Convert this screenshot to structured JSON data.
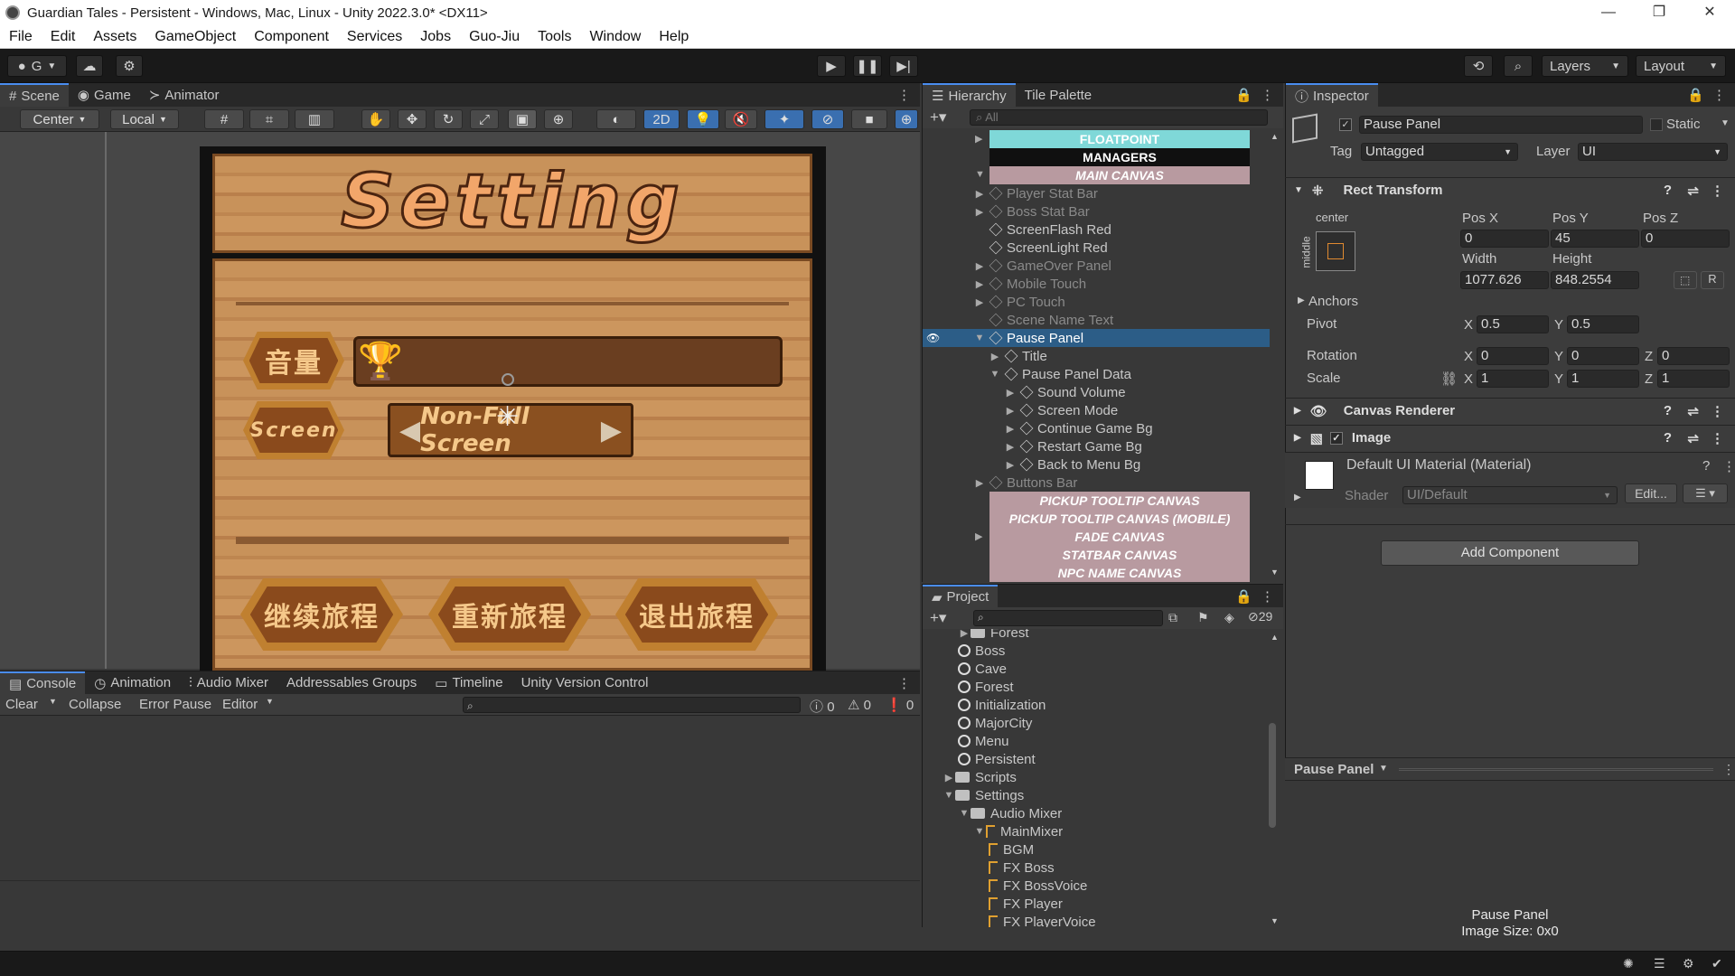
{
  "window": {
    "title": "Guardian Tales - Persistent - Windows, Mac, Linux - Unity 2022.3.0* <DX11>",
    "minimize": "—",
    "restore": "❐",
    "close": "✕"
  },
  "menu": [
    "File",
    "Edit",
    "Assets",
    "GameObject",
    "Component",
    "Services",
    "Jobs",
    "Guo-Jiu",
    "Tools",
    "Window",
    "Help"
  ],
  "toolbar": {
    "account": "G",
    "layers": "Layers",
    "layout": "Layout"
  },
  "scene_tabs": {
    "scene": "Scene",
    "game": "Game",
    "animator": "Animator"
  },
  "scene_bar": {
    "pivot": "Center",
    "space": "Local",
    "mode_2d": "2D"
  },
  "game_ui": {
    "title": "Setting",
    "volume_label": "音量",
    "screen_label": "Screen",
    "screen_mode_value": "Non-Full Screen",
    "volume_level": 0,
    "buttons": [
      "继续旅程",
      "重新旅程",
      "退出旅程"
    ]
  },
  "hierarchy": {
    "tab": "Hierarchy",
    "tab2": "Tile Palette",
    "search_placeholder": "All",
    "rows": [
      {
        "label": "FLOATPOINT",
        "kind": "bar",
        "bg": "#7fd8d8",
        "fg": "#ffffff",
        "italic": false
      },
      {
        "label": "MANAGERS",
        "kind": "bar",
        "bg": "#101010",
        "fg": "#ffffff",
        "italic": false
      },
      {
        "label": "MAIN CANVAS",
        "kind": "bar",
        "bg": "#b89aa0",
        "fg": "#ffffff",
        "italic": true
      },
      {
        "label": "Player Stat Bar",
        "indent": 1,
        "dim": true,
        "arrow": "▶"
      },
      {
        "label": "Boss Stat Bar",
        "indent": 1,
        "dim": true,
        "arrow": "▶"
      },
      {
        "label": "ScreenFlash Red",
        "indent": 1,
        "dim": false,
        "arrow": ""
      },
      {
        "label": "ScreenLight Red",
        "indent": 1,
        "dim": false,
        "arrow": ""
      },
      {
        "label": "GameOver Panel",
        "indent": 1,
        "dim": true,
        "arrow": "▶"
      },
      {
        "label": "Mobile Touch",
        "indent": 1,
        "dim": true,
        "arrow": "▶"
      },
      {
        "label": "PC Touch",
        "indent": 1,
        "dim": true,
        "arrow": "▶"
      },
      {
        "label": "Scene Name Text",
        "indent": 1,
        "dim": true,
        "arrow": ""
      },
      {
        "label": "Pause Panel",
        "indent": 1,
        "dim": false,
        "arrow": "▼",
        "selected": true
      },
      {
        "label": "Title",
        "indent": 2,
        "dim": false,
        "arrow": "▶"
      },
      {
        "label": "Pause Panel Data",
        "indent": 2,
        "dim": false,
        "arrow": "▼"
      },
      {
        "label": "Sound Volume",
        "indent": 3,
        "dim": false,
        "arrow": "▶"
      },
      {
        "label": "Screen Mode",
        "indent": 3,
        "dim": false,
        "arrow": "▶"
      },
      {
        "label": "Continue Game Bg",
        "indent": 3,
        "dim": false,
        "arrow": "▶"
      },
      {
        "label": "Restart Game Bg",
        "indent": 3,
        "dim": false,
        "arrow": "▶"
      },
      {
        "label": "Back to Menu Bg",
        "indent": 3,
        "dim": false,
        "arrow": "▶"
      },
      {
        "label": "Buttons Bar",
        "indent": 1,
        "dim": true,
        "arrow": "▶"
      },
      {
        "label": "PICKUP TOOLTIP CANVAS",
        "kind": "bar",
        "bg": "#b89aa0",
        "fg": "#ffffff",
        "italic": true
      },
      {
        "label": "PICKUP TOOLTIP CANVAS  (MOBILE)",
        "kind": "bar",
        "bg": "#b89aa0",
        "fg": "#ffffff",
        "italic": true
      },
      {
        "label": "FADE CANVAS",
        "kind": "bar",
        "bg": "#b89aa0",
        "fg": "#ffffff",
        "italic": true
      },
      {
        "label": "STATBAR CANVAS",
        "kind": "bar",
        "bg": "#b89aa0",
        "fg": "#ffffff",
        "italic": true
      },
      {
        "label": "NPC NAME CANVAS",
        "kind": "bar",
        "bg": "#b89aa0",
        "fg": "#ffffff",
        "italic": true
      }
    ]
  },
  "project": {
    "tab": "Project",
    "hidden_count": "29",
    "rows": [
      {
        "label": "Forest",
        "indent": 1,
        "icon": "folder",
        "arrow": "▶"
      },
      {
        "label": "Boss",
        "indent": 1,
        "icon": "unity"
      },
      {
        "label": "Cave",
        "indent": 1,
        "icon": "unity"
      },
      {
        "label": "Forest",
        "indent": 1,
        "icon": "unity"
      },
      {
        "label": "Initialization",
        "indent": 1,
        "icon": "unity"
      },
      {
        "label": "MajorCity",
        "indent": 1,
        "icon": "unity"
      },
      {
        "label": "Menu",
        "indent": 1,
        "icon": "unity"
      },
      {
        "label": "Persistent",
        "indent": 1,
        "icon": "unity"
      },
      {
        "label": "Scripts",
        "indent": 0,
        "icon": "folder",
        "arrow": "▶"
      },
      {
        "label": "Settings",
        "indent": 0,
        "icon": "folder",
        "arrow": "▼"
      },
      {
        "label": "Audio Mixer",
        "indent": 1,
        "icon": "folder",
        "arrow": "▼"
      },
      {
        "label": "MainMixer",
        "indent": 2,
        "icon": "mixer",
        "arrow": "▼"
      },
      {
        "label": "BGM",
        "indent": 3,
        "icon": "group"
      },
      {
        "label": "FX Boss",
        "indent": 3,
        "icon": "group"
      },
      {
        "label": "FX BossVoice",
        "indent": 3,
        "icon": "group"
      },
      {
        "label": "FX Player",
        "indent": 3,
        "icon": "group"
      },
      {
        "label": "FX PlayerVoice",
        "indent": 3,
        "icon": "group"
      }
    ]
  },
  "console": {
    "tabs": [
      "Console",
      "Animation",
      "Audio Mixer",
      "Addressables Groups",
      "Timeline",
      "Unity Version Control"
    ],
    "clear": "Clear",
    "collapse": "Collapse",
    "error_pause": "Error Pause",
    "editor": "Editor",
    "count_log": "0",
    "count_warn": "0",
    "count_error": "0"
  },
  "inspector": {
    "tab": "Inspector",
    "object_name": "Pause Panel",
    "static_label": "Static",
    "tag_label": "Tag",
    "tag_value": "Untagged",
    "layer_label": "Layer",
    "layer_value": "UI",
    "rect_transform": "Rect Transform",
    "anchor_preset_h": "center",
    "anchor_preset_v": "middle",
    "pos_x_label": "Pos X",
    "pos_x": "0",
    "pos_y_label": "Pos Y",
    "pos_y": "45",
    "pos_z_label": "Pos Z",
    "pos_z": "0",
    "width_label": "Width",
    "width": "1077.626",
    "height_label": "Height",
    "height": "848.2554",
    "anchors": "Anchors",
    "pivot_label": "Pivot",
    "pivot_x": "0.5",
    "pivot_y": "0.5",
    "rotation_label": "Rotation",
    "rot_x": "0",
    "rot_y": "0",
    "rot_z": "0",
    "scale_label": "Scale",
    "scale_x": "1",
    "scale_y": "1",
    "scale_z": "1",
    "canvas_renderer": "Canvas Renderer",
    "image": "Image",
    "material": "Default UI Material (Material)",
    "shader_label": "Shader",
    "shader_value": "UI/Default",
    "edit_button": "Edit...",
    "add_component": "Add Component",
    "preview_title": "Pause Panel",
    "preview_name": "Pause Panel",
    "preview_size": "Image Size: 0x0",
    "axis_x": "X",
    "axis_y": "Y",
    "axis_z": "Z",
    "reset": "R"
  }
}
